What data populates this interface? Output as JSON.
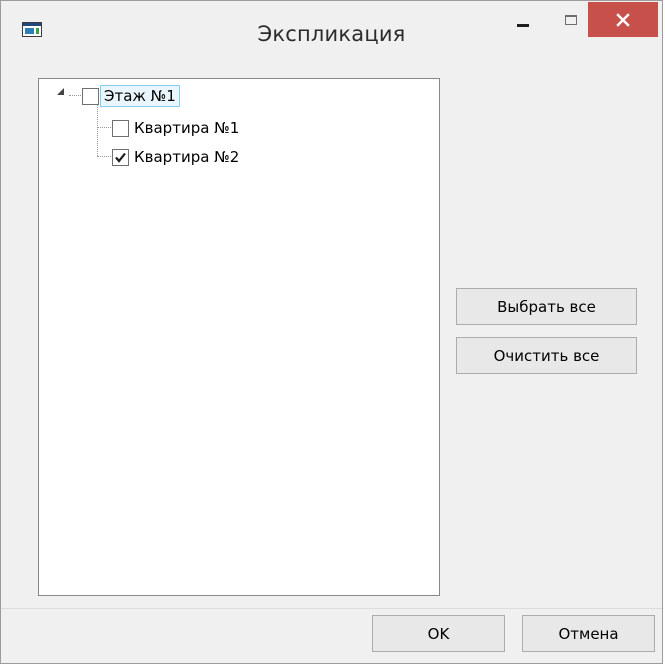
{
  "window": {
    "title": "Экспликация",
    "close_glyph": "✕",
    "icons": {
      "app": "application-window-icon",
      "minimize": "minimize-icon",
      "maximize": "maximize-icon",
      "close": "close-icon"
    },
    "close_color": "#c7504a"
  },
  "tree": {
    "root": {
      "label": "Этаж №1",
      "checked": false,
      "expanded": true,
      "selected": true,
      "children": [
        {
          "label": "Квартира №1",
          "checked": false
        },
        {
          "label": "Квартира №2",
          "checked": true
        }
      ]
    }
  },
  "actions": {
    "select_all": "Выбрать все",
    "clear_all": "Очистить все"
  },
  "footer": {
    "ok": "OK",
    "cancel": "Отмена"
  },
  "colors": {
    "selection_fill": "#eaf6fd",
    "selection_border": "#88cdf1",
    "close_button": "#c7504a"
  }
}
